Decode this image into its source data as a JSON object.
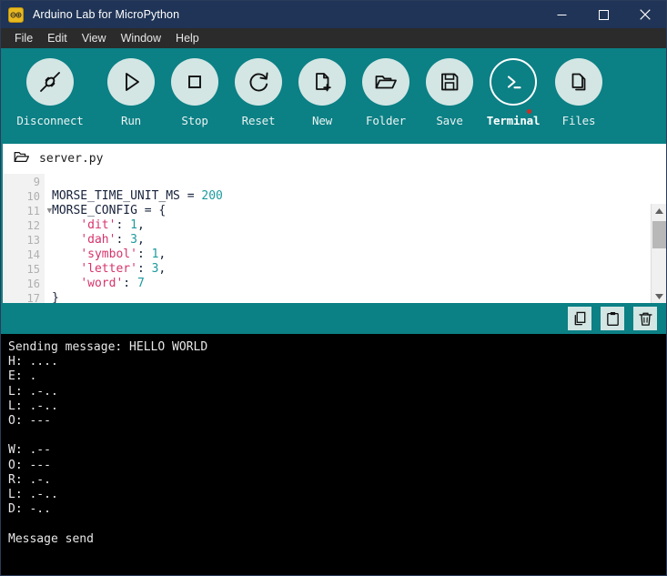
{
  "window": {
    "title": "Arduino Lab for MicroPython",
    "app_icon": "arduino-logo-icon",
    "controls": {
      "minimize": "minimize-icon",
      "maximize": "maximize-icon",
      "close": "close-icon"
    }
  },
  "menubar": {
    "items": [
      {
        "label": "File"
      },
      {
        "label": "Edit"
      },
      {
        "label": "View"
      },
      {
        "label": "Window"
      },
      {
        "label": "Help"
      }
    ]
  },
  "toolbar": {
    "buttons": [
      {
        "label": "Disconnect",
        "icon": "plug-disconnect-icon",
        "active": false
      },
      {
        "label": "Run",
        "icon": "play-icon",
        "active": false
      },
      {
        "label": "Stop",
        "icon": "stop-square-icon",
        "active": false
      },
      {
        "label": "Reset",
        "icon": "refresh-circular-arrow-icon",
        "active": false
      },
      {
        "label": "New",
        "icon": "new-file-plus-icon",
        "active": false
      },
      {
        "label": "Folder",
        "icon": "open-folder-icon",
        "active": false
      },
      {
        "label": "Save",
        "icon": "floppy-disk-save-icon",
        "active": false
      },
      {
        "label": "Terminal",
        "icon": "terminal-prompt-icon",
        "active": true,
        "badge": true
      },
      {
        "label": "Files",
        "icon": "copy-files-icon",
        "active": false
      }
    ]
  },
  "editor": {
    "tab": {
      "icon": "open-folder-icon",
      "filename": "server.py"
    },
    "first_line_number": 9,
    "fold_line_number": 11,
    "lines": [
      {
        "number": 9,
        "tokens": []
      },
      {
        "number": 10,
        "tokens": [
          {
            "t": "MORSE_TIME_UNIT_MS = ",
            "c": "plain"
          },
          {
            "t": "200",
            "c": "num"
          }
        ]
      },
      {
        "number": 11,
        "tokens": [
          {
            "t": "MORSE_CONFIG = {",
            "c": "plain"
          }
        ]
      },
      {
        "number": 12,
        "tokens": [
          {
            "t": "    ",
            "c": "plain"
          },
          {
            "t": "'dit'",
            "c": "str"
          },
          {
            "t": ": ",
            "c": "plain"
          },
          {
            "t": "1",
            "c": "num"
          },
          {
            "t": ",",
            "c": "plain"
          }
        ]
      },
      {
        "number": 13,
        "tokens": [
          {
            "t": "    ",
            "c": "plain"
          },
          {
            "t": "'dah'",
            "c": "str"
          },
          {
            "t": ": ",
            "c": "plain"
          },
          {
            "t": "3",
            "c": "num"
          },
          {
            "t": ",",
            "c": "plain"
          }
        ]
      },
      {
        "number": 14,
        "tokens": [
          {
            "t": "    ",
            "c": "plain"
          },
          {
            "t": "'symbol'",
            "c": "str"
          },
          {
            "t": ": ",
            "c": "plain"
          },
          {
            "t": "1",
            "c": "num"
          },
          {
            "t": ",",
            "c": "plain"
          }
        ]
      },
      {
        "number": 15,
        "tokens": [
          {
            "t": "    ",
            "c": "plain"
          },
          {
            "t": "'letter'",
            "c": "str"
          },
          {
            "t": ": ",
            "c": "plain"
          },
          {
            "t": "3",
            "c": "num"
          },
          {
            "t": ",",
            "c": "plain"
          }
        ]
      },
      {
        "number": 16,
        "tokens": [
          {
            "t": "    ",
            "c": "plain"
          },
          {
            "t": "'word'",
            "c": "str"
          },
          {
            "t": ": ",
            "c": "plain"
          },
          {
            "t": "7",
            "c": "num"
          }
        ]
      },
      {
        "number": 17,
        "tokens": [
          {
            "t": "}",
            "c": "plain"
          }
        ]
      }
    ],
    "scrollbar": {
      "up_arrow": "triangle-up-icon",
      "down_arrow": "triangle-down-icon"
    }
  },
  "terminal_toolbar": {
    "buttons": [
      {
        "icon": "copy-icon",
        "name": "copy-button"
      },
      {
        "icon": "paste-clipboard-icon",
        "name": "paste-button"
      },
      {
        "icon": "trash-delete-icon",
        "name": "clear-button"
      }
    ]
  },
  "terminal": {
    "lines": [
      "Sending message: HELLO WORLD",
      "H: ....",
      "E: .",
      "L: .-..",
      "L: .-..",
      "O: ---",
      "",
      "W: .--",
      "O: ---",
      "R: .-.",
      "L: .-..",
      "D: -..",
      "",
      "Message send"
    ]
  },
  "colors": {
    "titlebar": "#1f3456",
    "menubar": "#2b2b2b",
    "accent_teal": "#0b8085",
    "icon_circle": "#d3e6e4",
    "terminal_bg": "#000000",
    "terminal_fg": "#e8e8e8",
    "badge_red": "#cf2b24",
    "code_string": "#d6336c",
    "code_number": "#1d9a9e"
  }
}
